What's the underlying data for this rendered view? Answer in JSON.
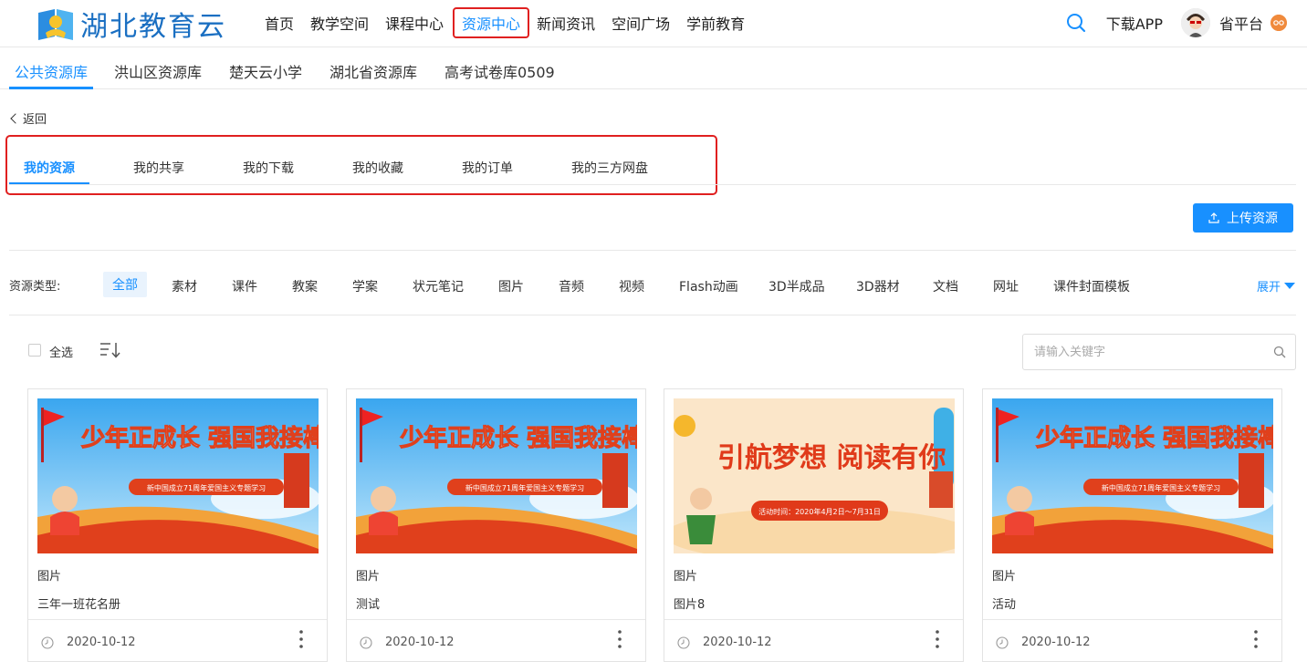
{
  "header": {
    "logo_text": "湖北教育云",
    "nav": [
      "首页",
      "教学空间",
      "课程中心",
      "资源中心",
      "新闻资讯",
      "空间广场",
      "学前教育"
    ],
    "active_nav": "资源中心",
    "download_app": "下载APP",
    "platform": "省平台"
  },
  "library_tabs": [
    "公共资源库",
    "洪山区资源库",
    "楚天云小学",
    "湖北省资源库",
    "高考试卷库0509"
  ],
  "back_label": "返回",
  "my_tabs": [
    "我的资源",
    "我的共享",
    "我的下载",
    "我的收藏",
    "我的订单",
    "我的三方网盘"
  ],
  "upload_label": "上传资源",
  "filter": {
    "label": "资源类型:",
    "items": [
      "全部",
      "素材",
      "课件",
      "教案",
      "学案",
      "状元笔记",
      "图片",
      "音频",
      "视频",
      "Flash动画",
      "3D半成品",
      "3D器材",
      "文档",
      "网址",
      "课件封面模板"
    ],
    "expand": "展开"
  },
  "select_all": "全选",
  "search_placeholder": "请输入关键字",
  "cards": [
    {
      "banner_main": "少年正成长  强国我接棒",
      "banner_sub": "新中国成立71周年爱国主义专题学习",
      "type": "图片",
      "title": "三年一班花名册",
      "date": "2020-10-12"
    },
    {
      "banner_main": "少年正成长  强国我接棒",
      "banner_sub": "新中国成立71周年爱国主义专题学习",
      "type": "图片",
      "title": "测试",
      "date": "2020-10-12"
    },
    {
      "banner_main": "引航梦想  阅读有你",
      "banner_sub": "活动时间：2020年4月2日～7月31日",
      "type": "图片",
      "title": "图片8",
      "date": "2020-10-12"
    },
    {
      "banner_main": "少年正成长  强国我接棒",
      "banner_sub": "新中国成立71周年爱国主义专题学习",
      "type": "图片",
      "title": "活动",
      "date": "2020-10-12"
    }
  ],
  "colors": {
    "accent": "#1890ff",
    "highlight_border": "#e02020"
  }
}
